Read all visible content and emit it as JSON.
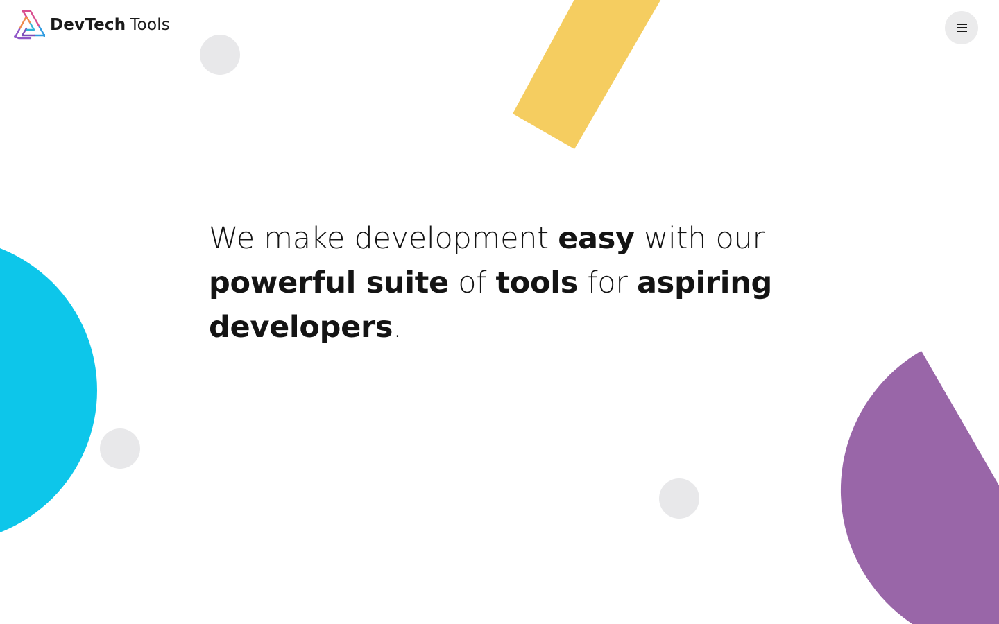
{
  "header": {
    "brand_word1": "DevTech",
    "brand_word2": "Tools",
    "logo_icon": "devtech-triangle-logo",
    "menu_icon": "hamburger-menu-icon"
  },
  "hero": {
    "parts": [
      {
        "text": "We make development ",
        "bold": false
      },
      {
        "text": "easy",
        "bold": true
      },
      {
        "text": " with our ",
        "bold": false
      },
      {
        "text": "powerful suite",
        "bold": true
      },
      {
        "text": " of ",
        "bold": false
      },
      {
        "text": "tools",
        "bold": true
      },
      {
        "text": " for ",
        "bold": false
      },
      {
        "text": "aspiring developers",
        "bold": true
      },
      {
        "text": ".",
        "bold": false
      }
    ]
  },
  "colors": {
    "yellow": "#f5cd60",
    "cyan": "#0dc6ea",
    "purple": "#9966a8",
    "light_gray": "#e8e8ea",
    "menu_bg": "#ebebec",
    "text": "#141414"
  }
}
